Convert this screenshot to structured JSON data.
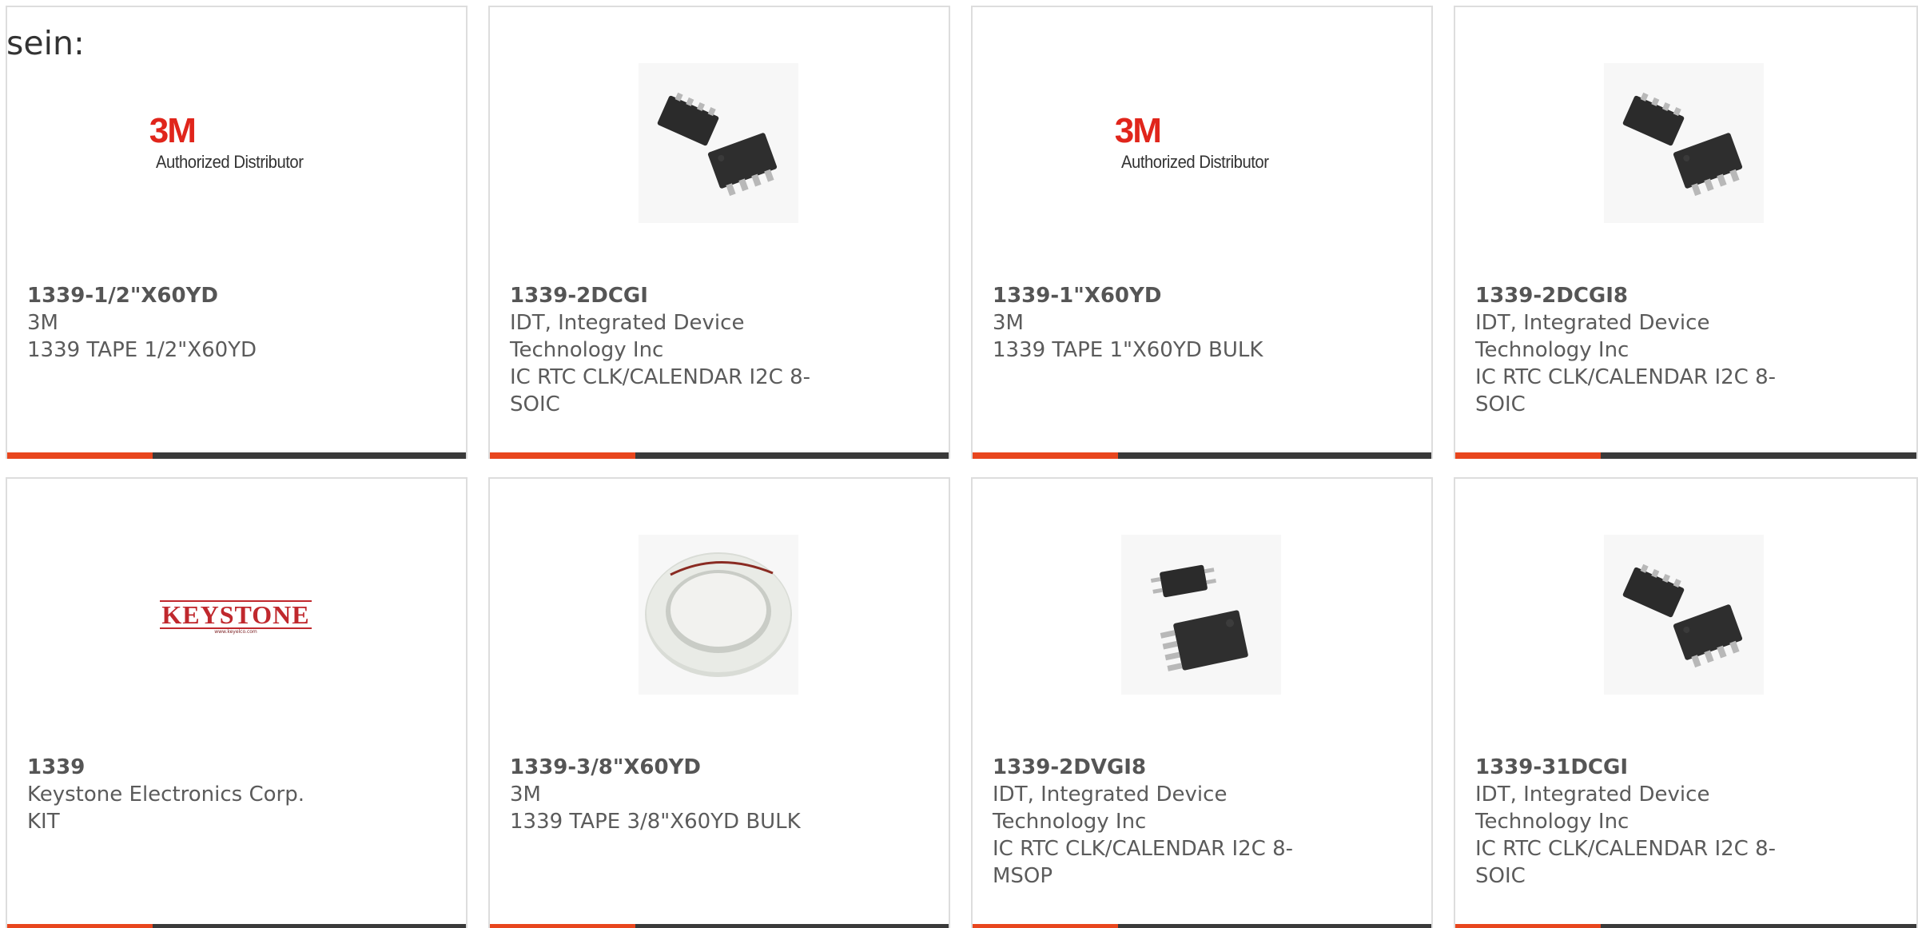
{
  "lead_text": "sein:",
  "colors": {
    "accent": "#e8461e",
    "bar": "#3a3a3a",
    "border": "#dddddd",
    "text": "#5b5b5b"
  },
  "products": [
    {
      "part": "1339-1/2\"X60YD",
      "manufacturer": "3M",
      "description": "1339 TAPE 1/2\"X60YD",
      "image": "3m-authorized-distributor-logo",
      "logo_mark": "3M",
      "logo_sub": "Authorized Distributor"
    },
    {
      "part": "1339-2DCGI",
      "manufacturer": "IDT, Integrated Device Technology Inc",
      "description": "IC RTC CLK/CALENDAR I2C 8-SOIC",
      "image": "soic-8-chip-photo"
    },
    {
      "part": "1339-1\"X60YD",
      "manufacturer": "3M",
      "description": "1339 TAPE 1\"X60YD BULK",
      "image": "3m-authorized-distributor-logo",
      "logo_mark": "3M",
      "logo_sub": "Authorized Distributor"
    },
    {
      "part": "1339-2DCGI8",
      "manufacturer": "IDT, Integrated Device Technology Inc",
      "description": "IC RTC CLK/CALENDAR I2C 8-SOIC",
      "image": "soic-8-chip-photo"
    },
    {
      "part": "1339",
      "manufacturer": "Keystone Electronics Corp.",
      "description": "KIT",
      "image": "keystone-logo",
      "logo_word": "KEYSTONE",
      "logo_url": "www.keyelco.com"
    },
    {
      "part": "1339-3/8\"X60YD",
      "manufacturer": "3M",
      "description": "1339 TAPE 3/8\"X60YD BULK",
      "image": "tape-roll-photo"
    },
    {
      "part": "1339-2DVGI8",
      "manufacturer": "IDT, Integrated Device Technology Inc",
      "description": "IC RTC CLK/CALENDAR I2C 8-MSOP",
      "image": "msop-8-chip-photo"
    },
    {
      "part": "1339-31DCGI",
      "manufacturer": "IDT, Integrated Device Technology Inc",
      "description": "IC RTC CLK/CALENDAR I2C 8-SOIC",
      "image": "soic-8-chip-photo"
    }
  ]
}
